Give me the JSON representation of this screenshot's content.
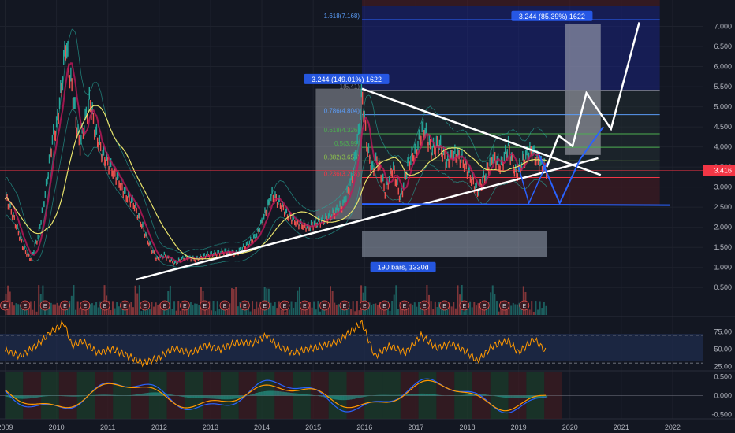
{
  "chart_data": {
    "type": "line",
    "x_axis": {
      "ticks": [
        "2009",
        "2010",
        "2011",
        "2012",
        "2013",
        "2014",
        "2015",
        "2016",
        "2017",
        "2018",
        "2019",
        "2020",
        "2021",
        "2022"
      ],
      "tick_years": [
        2009,
        2010,
        2011,
        2012,
        2013,
        2014,
        2015,
        2016,
        2017,
        2018,
        2019,
        2020,
        2021,
        2022
      ],
      "range": [
        2008.9,
        2022.6
      ]
    },
    "y_axis": {
      "ticks": [
        "7.000",
        "6.500",
        "6.000",
        "5.500",
        "5.000",
        "4.500",
        "4.000",
        "3.500",
        "3.000",
        "2.500",
        "2.000",
        "1.500",
        "1.000",
        "0.500"
      ],
      "range": [
        0.25,
        7.5
      ]
    },
    "last_price": {
      "label": "3.416",
      "value": 3.416,
      "color": "#f23645"
    },
    "price_series": [
      [
        2009.0,
        2.8
      ],
      [
        2009.15,
        2.3
      ],
      [
        2009.35,
        1.5
      ],
      [
        2009.5,
        1.2
      ],
      [
        2009.65,
        1.8
      ],
      [
        2009.8,
        3.0
      ],
      [
        2009.92,
        4.2
      ],
      [
        2010.0,
        4.5
      ],
      [
        2010.1,
        5.5
      ],
      [
        2010.18,
        6.6
      ],
      [
        2010.25,
        5.9
      ],
      [
        2010.35,
        5.0
      ],
      [
        2010.45,
        4.0
      ],
      [
        2010.55,
        4.6
      ],
      [
        2010.65,
        5.2
      ],
      [
        2010.75,
        4.4
      ],
      [
        2010.9,
        3.8
      ],
      [
        2011.05,
        3.5
      ],
      [
        2011.2,
        3.2
      ],
      [
        2011.35,
        2.8
      ],
      [
        2011.5,
        2.6
      ],
      [
        2011.65,
        2.1
      ],
      [
        2011.8,
        1.6
      ],
      [
        2011.95,
        1.2
      ],
      [
        2012.1,
        1.3
      ],
      [
        2012.3,
        1.1
      ],
      [
        2012.5,
        1.25
      ],
      [
        2012.7,
        1.2
      ],
      [
        2012.9,
        1.3
      ],
      [
        2013.1,
        1.35
      ],
      [
        2013.3,
        1.4
      ],
      [
        2013.5,
        1.35
      ],
      [
        2013.7,
        1.55
      ],
      [
        2013.9,
        1.8
      ],
      [
        2014.05,
        2.3
      ],
      [
        2014.2,
        2.8
      ],
      [
        2014.35,
        2.6
      ],
      [
        2014.5,
        2.3
      ],
      [
        2014.7,
        2.1
      ],
      [
        2014.9,
        2.0
      ],
      [
        2015.05,
        2.1
      ],
      [
        2015.25,
        2.2
      ],
      [
        2015.45,
        2.4
      ],
      [
        2015.6,
        2.6
      ],
      [
        2015.75,
        3.2
      ],
      [
        2015.88,
        4.3
      ],
      [
        2015.95,
        5.35
      ],
      [
        2016.05,
        4.0
      ],
      [
        2016.15,
        3.4
      ],
      [
        2016.25,
        3.7
      ],
      [
        2016.4,
        2.9
      ],
      [
        2016.55,
        3.5
      ],
      [
        2016.7,
        2.7
      ],
      [
        2016.85,
        3.6
      ],
      [
        2017.0,
        3.9
      ],
      [
        2017.15,
        4.5
      ],
      [
        2017.3,
        3.9
      ],
      [
        2017.45,
        4.1
      ],
      [
        2017.6,
        3.6
      ],
      [
        2017.75,
        3.8
      ],
      [
        2017.9,
        3.7
      ],
      [
        2018.05,
        3.3
      ],
      [
        2018.2,
        2.9
      ],
      [
        2018.35,
        3.3
      ],
      [
        2018.5,
        3.8
      ],
      [
        2018.65,
        3.5
      ],
      [
        2018.8,
        4.0
      ],
      [
        2018.95,
        3.3
      ],
      [
        2019.1,
        3.7
      ],
      [
        2019.25,
        3.9
      ],
      [
        2019.4,
        3.6
      ],
      [
        2019.55,
        3.416
      ]
    ],
    "fib_levels": [
      {
        "label": "1(5.41)",
        "value": 5.41,
        "color": "#787b86"
      },
      {
        "label": "0.786(4.804)",
        "value": 4.804,
        "color": "#5b9cf6"
      },
      {
        "label": "0.618(4.326)",
        "value": 4.326,
        "color": "#4caf50"
      },
      {
        "label": "0.5(3.99)",
        "value": 3.99,
        "color": "#4caf50"
      },
      {
        "label": "0.382(3.653)",
        "value": 3.653,
        "color": "#8bc34a"
      },
      {
        "label": "0.236(3.238)",
        "value": 3.238,
        "color": "#f23645"
      }
    ],
    "fib_top_label": "1.618(7.168)",
    "fib_top_value": 7.168,
    "annotations": [
      {
        "text": "3.244 (149.01%) 1622",
        "x": 2015.65,
        "y": 5.66
      },
      {
        "text": "3.244 (85.39%) 1622",
        "x": 2019.65,
        "y": 7.23
      },
      {
        "text": "190 bars, 1330d",
        "x": 2016.75,
        "y": 0.98
      }
    ],
    "trendlines": [
      {
        "from": [
          2011.55,
          0.7
        ],
        "to": [
          2020.55,
          3.72
        ],
        "color": "#ffffff"
      },
      {
        "from": [
          2015.95,
          5.45
        ],
        "to": [
          2020.6,
          3.3
        ],
        "color": "#ffffff"
      },
      {
        "from": [
          2015.95,
          2.58
        ],
        "to": [
          2021.95,
          2.55
        ],
        "color": "#2962ff"
      }
    ],
    "projection_path": [
      [
        2019.55,
        3.5
      ],
      [
        2019.78,
        4.28
      ],
      [
        2020.05,
        4.02
      ],
      [
        2020.32,
        5.34
      ],
      [
        2020.8,
        4.45
      ],
      [
        2021.35,
        7.1
      ]
    ],
    "earnings_markers": [
      "E",
      "E",
      "E",
      "E",
      "E",
      "E",
      "E",
      "E",
      "E",
      "E",
      "E",
      "E",
      "E",
      "E",
      "E",
      "E",
      "E",
      "E",
      "E",
      "E",
      "E",
      "E",
      "E",
      "E",
      "E",
      "E",
      "E"
    ],
    "rsi": {
      "ticks": [
        "75.00",
        "50.00",
        "25.00"
      ],
      "range": [
        20,
        95
      ],
      "series": [
        [
          2009.0,
          48
        ],
        [
          2009.3,
          40
        ],
        [
          2009.6,
          55
        ],
        [
          2009.9,
          75
        ],
        [
          2010.15,
          88
        ],
        [
          2010.3,
          55
        ],
        [
          2010.5,
          62
        ],
        [
          2010.8,
          45
        ],
        [
          2011.1,
          50
        ],
        [
          2011.4,
          40
        ],
        [
          2011.7,
          30
        ],
        [
          2012.0,
          38
        ],
        [
          2012.3,
          52
        ],
        [
          2012.6,
          44
        ],
        [
          2012.9,
          55
        ],
        [
          2013.2,
          50
        ],
        [
          2013.5,
          60
        ],
        [
          2013.8,
          58
        ],
        [
          2014.1,
          70
        ],
        [
          2014.3,
          55
        ],
        [
          2014.6,
          45
        ],
        [
          2014.9,
          50
        ],
        [
          2015.2,
          55
        ],
        [
          2015.5,
          62
        ],
        [
          2015.8,
          80
        ],
        [
          2015.95,
          88
        ],
        [
          2016.2,
          40
        ],
        [
          2016.5,
          55
        ],
        [
          2016.8,
          45
        ],
        [
          2017.1,
          70
        ],
        [
          2017.4,
          52
        ],
        [
          2017.7,
          58
        ],
        [
          2018.0,
          45
        ],
        [
          2018.2,
          33
        ],
        [
          2018.5,
          55
        ],
        [
          2018.8,
          62
        ],
        [
          2019.0,
          45
        ],
        [
          2019.3,
          65
        ],
        [
          2019.55,
          45
        ]
      ]
    },
    "macd": {
      "ticks": [
        "0.500",
        "0.000",
        "-0.500"
      ],
      "range": [
        -0.62,
        0.62
      ]
    }
  }
}
